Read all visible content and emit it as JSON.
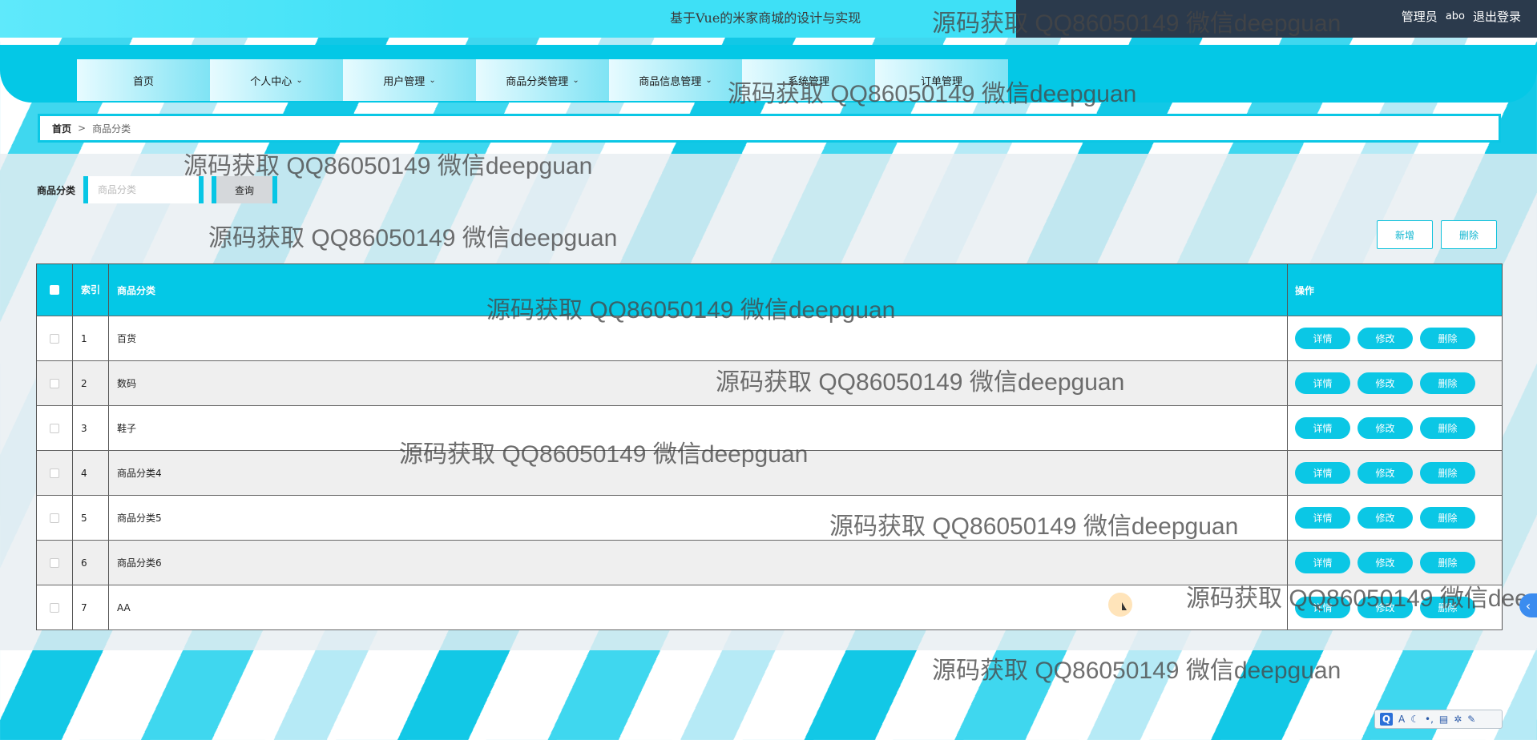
{
  "app": {
    "title": "基于Vue的米家商城的设计与实现",
    "role": "管理员",
    "username": "abo",
    "logout_label": "退出登录"
  },
  "nav": {
    "items": [
      {
        "label": "首页",
        "has_dropdown": false
      },
      {
        "label": "个人中心",
        "has_dropdown": true
      },
      {
        "label": "用户管理",
        "has_dropdown": true
      },
      {
        "label": "商品分类管理",
        "has_dropdown": true
      },
      {
        "label": "商品信息管理",
        "has_dropdown": true
      },
      {
        "label": "系统管理",
        "has_dropdown": false
      },
      {
        "label": "订单管理",
        "has_dropdown": false
      }
    ]
  },
  "breadcrumb": {
    "home": "首页",
    "separator": ">",
    "current": "商品分类"
  },
  "search": {
    "label": "商品分类",
    "placeholder": "商品分类",
    "value": "",
    "query_button": "查询"
  },
  "actions": {
    "add_label": "新增",
    "delete_label": "删除"
  },
  "table": {
    "headers": {
      "index": "索引",
      "name": "商品分类",
      "ops": "操作"
    },
    "op_labels": {
      "detail": "详情",
      "edit": "修改",
      "delete": "删除"
    },
    "rows": [
      {
        "index": "1",
        "name": "百货"
      },
      {
        "index": "2",
        "name": "数码"
      },
      {
        "index": "3",
        "name": "鞋子"
      },
      {
        "index": "4",
        "name": "商品分类4"
      },
      {
        "index": "5",
        "name": "商品分类5"
      },
      {
        "index": "6",
        "name": "商品分类6"
      },
      {
        "index": "7",
        "name": "AA"
      }
    ]
  },
  "watermark": {
    "text": "源码获取 QQ86050149 微信deepguan"
  },
  "ime_bar": {
    "label": "A"
  },
  "colors": {
    "accent": "#04c8e6",
    "top_bar": "#3ee0f6",
    "user_panel": "#2b3a4c"
  }
}
